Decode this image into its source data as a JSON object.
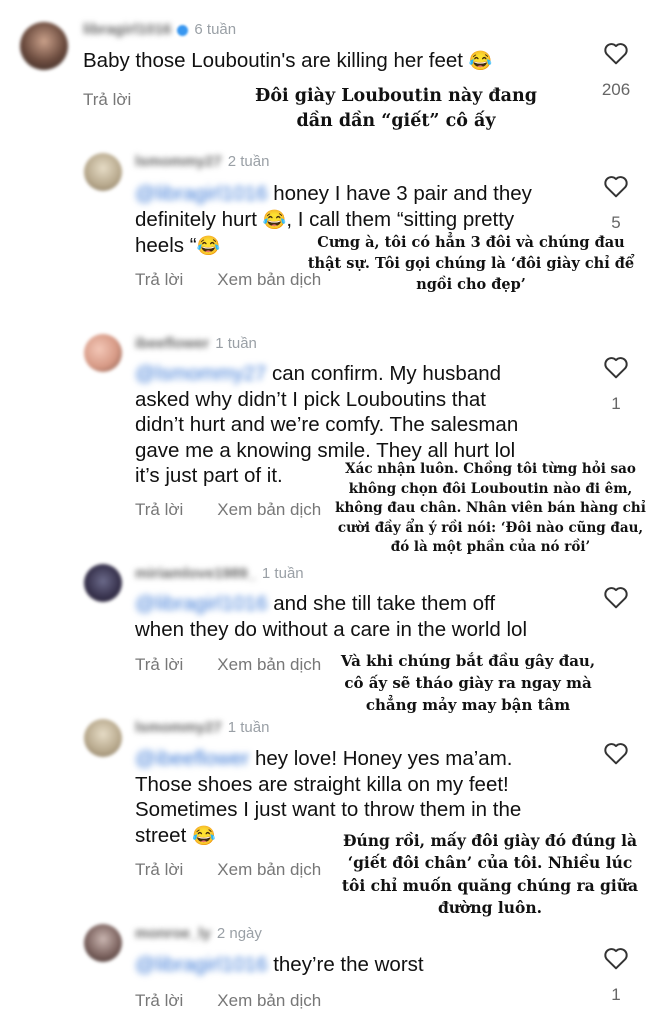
{
  "reply_label": "Trả lời",
  "translate_label": "Xem bản dịch",
  "comments": [
    {
      "username": "libragirl1016",
      "time": "6 tuần",
      "mention": "",
      "text": "Baby those Louboutin's are killing her feet",
      "emoji": "😂",
      "likes": "206",
      "overlay": "Đôi giày Louboutin này đang dần dần “giết” cô ấy"
    },
    {
      "username": "lsmommy27",
      "time": "2 tuần",
      "mention": "@libragirl1016",
      "text_lines": [
        "honey I have 3 pair and they",
        "definitely hurt",
        ", I call them “sitting pretty",
        "heels “"
      ],
      "emoji": "😂",
      "likes": "5",
      "overlay": "Cưng à, tôi có hẳn 3 đôi và chúng đau thật sự. Tôi gọi chúng là ‘đôi giày chỉ để ngồi cho đẹp’"
    },
    {
      "username": "ibeeflower",
      "time": "1 tuần",
      "mention": "@lsmommy27",
      "text_lines": [
        "can confirm. My husband",
        "asked why didn’t I pick Louboutins that",
        "didn’t hurt and we’re comfy. The salesman",
        "gave me a knowing smile. They all hurt lol",
        "it’s just part of it."
      ],
      "likes": "1",
      "overlay": "Xác nhận luôn. Chồng tôi từng hỏi sao không chọn đôi Louboutin nào đi êm, không đau chân. Nhân viên bán hàng chỉ cười đầy ẩn ý rồi nói: ‘Đôi nào cũng đau, đó là một phần của nó rồi’"
    },
    {
      "username": "miriamlove1989_",
      "time": "1 tuần",
      "mention": "@libragirl1016",
      "text_lines": [
        "and she till take them off",
        "when they do without a care in the world lol"
      ],
      "likes": "",
      "overlay": "Và khi chúng bắt đầu gây đau, cô ấy sẽ tháo giày ra ngay mà chẳng mảy may bận tâm"
    },
    {
      "username": "lsmommy27",
      "time": "1 tuần",
      "mention": "@ibeeflower",
      "text_lines": [
        "hey love! Honey yes ma’am.",
        "Those shoes are straight killa on my feet!",
        "Sometimes I just want to throw them in the",
        "street"
      ],
      "emoji": "😂",
      "likes": "",
      "overlay": "Đúng rồi, mấy đôi giày đó đúng là ‘giết đôi chân’ của tôi. Nhiều lúc tôi chỉ muốn quăng chúng ra giữa đường luôn."
    },
    {
      "username": "monroe_ly",
      "time": "2 ngày",
      "mention": "@libragirl1016",
      "text_lines": [
        "they’re the worst"
      ],
      "likes": "1",
      "overlay": ""
    }
  ],
  "colors": {
    "mention": "#3b79d6",
    "meta": "#9aa0a6",
    "heart": "#333333"
  },
  "icons": {
    "like": "heart-outline-icon",
    "verified": "verified-badge-icon"
  }
}
